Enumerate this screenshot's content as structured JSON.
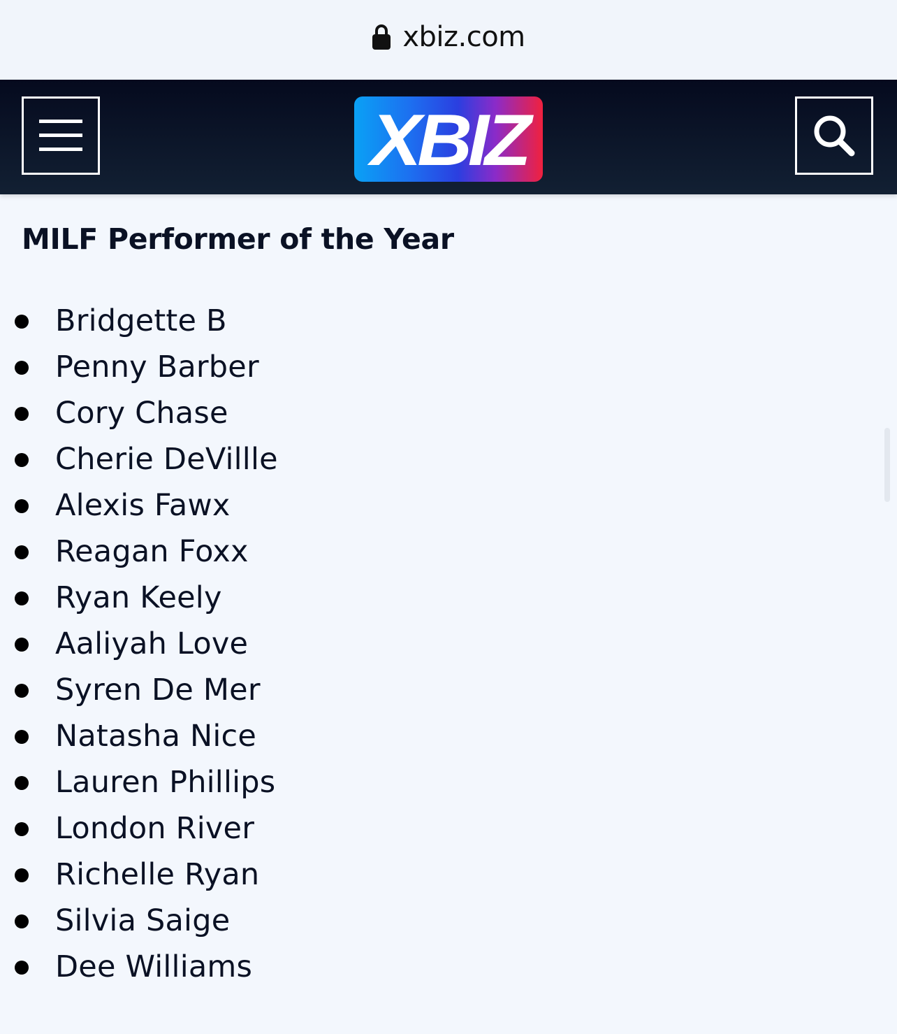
{
  "browser": {
    "url": "xbiz.com",
    "lock_icon": "lock-icon"
  },
  "header": {
    "menu_icon": "hamburger-menu-icon",
    "logo_text": "XBIZ",
    "search_icon": "search-icon",
    "colors": {
      "header_bg": "#050a1e",
      "logo_gradient_start": "#0aa1f5",
      "logo_gradient_end": "#f0213e"
    }
  },
  "main": {
    "title": "MILF Performer of the Year",
    "nominees": [
      "Bridgette B",
      "Penny Barber",
      "Cory Chase",
      "Cherie DeVillle",
      "Alexis Fawx",
      "Reagan Foxx",
      "Ryan Keely",
      "Aaliyah Love",
      "Syren De Mer",
      "Natasha Nice",
      "Lauren Phillips",
      "London River",
      "Richelle Ryan",
      "Silvia Saige",
      "Dee Williams"
    ]
  }
}
